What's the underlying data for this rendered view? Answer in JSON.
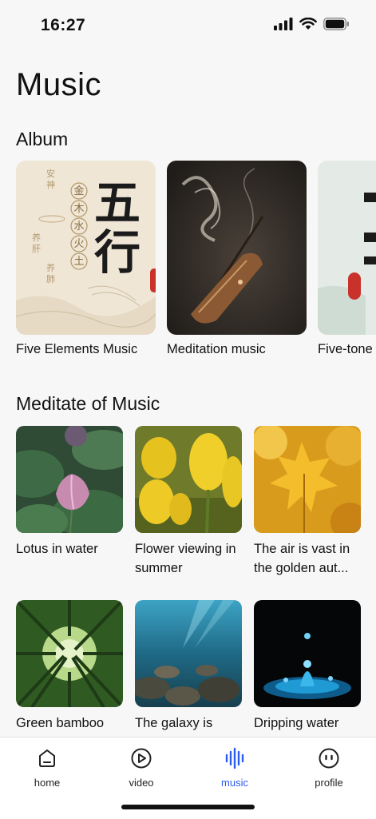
{
  "status": {
    "time": "16:27"
  },
  "page": {
    "title": "Music"
  },
  "album": {
    "section_title": "Album",
    "items": [
      {
        "label": "Five Elements Music",
        "art": {
          "big1": "五",
          "big2": "行",
          "small": [
            "金",
            "木",
            "水",
            "火",
            "土"
          ],
          "side": [
            "安神",
            "养肝",
            "养肺"
          ]
        }
      },
      {
        "label": "Meditation music"
      },
      {
        "label": "Five-tone"
      }
    ]
  },
  "meditate": {
    "section_title": "Meditate of Music",
    "items": [
      {
        "label": "Lotus in water"
      },
      {
        "label": "Flower viewing in summer"
      },
      {
        "label": "The air is vast in the golden aut..."
      },
      {
        "label": "Green bamboo"
      },
      {
        "label": "The galaxy is"
      },
      {
        "label": "Dripping water"
      }
    ]
  },
  "tabbar": {
    "home": "home",
    "video": "video",
    "music": "music",
    "profile": "profile",
    "active": "music",
    "active_color": "#2e5bf0"
  }
}
